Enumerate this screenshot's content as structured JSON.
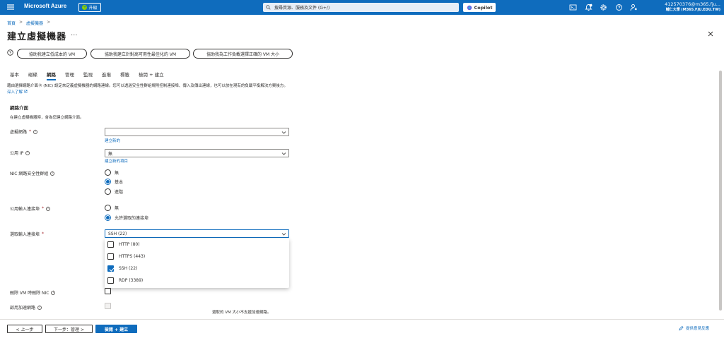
{
  "topbar": {
    "brand": "Microsoft Azure",
    "upgrade_label": "升級",
    "search_placeholder": "搜尋資源、服務及文件 (G+/)",
    "copilot_label": "Copilot",
    "notification_count": "2",
    "account_email": "412570376@m365.fju...",
    "account_org": "輔仁大學 (M365.FJU.EDU.TW)"
  },
  "breadcrumb": {
    "home": "首頁",
    "sep": ">",
    "parent": "虛擬機器",
    "sep2": ">"
  },
  "page": {
    "title": "建立虛擬機器",
    "more": "..."
  },
  "presets": [
    "協助我建立低成本的 VM",
    "協助我建立針對高可用性最佳化的 VM",
    "協助我為工作負載選擇正確的 VM 大小"
  ],
  "tabs": [
    "基本",
    "磁碟",
    "網路",
    "管理",
    "監視",
    "進階",
    "標籤",
    "檢閱 + 建立"
  ],
  "active_tab": "網路",
  "description": {
    "text": "藉由選擇網路介面卡 (NIC) 設定來定義虛擬機器的網路連線。您可以透過安全性群組規則控制連接埠、傳入及傳出連線，也可以放在現有的負載平衡解決方案後方。",
    "link": "深入了解"
  },
  "section": {
    "heading": "網路介面",
    "subtitle": "在建立虛擬機器時，會為您建立網路介面。"
  },
  "fields": {
    "vnet": {
      "label": "虛擬網路",
      "required": "*",
      "value": "",
      "link": "建立新的"
    },
    "public_ip": {
      "label": "公用 IP",
      "value": "無",
      "link": "建立新的項目"
    },
    "nsg": {
      "label": "NIC 網路安全性群組",
      "options": [
        "無",
        "基本",
        "進階"
      ],
      "selected": 1
    },
    "inbound": {
      "label": "公用輸入連接埠",
      "required": "*",
      "options": [
        "無",
        "允許選取的連接埠"
      ],
      "selected": 1
    },
    "select_ports": {
      "label": "選取輸入連接埠",
      "required": "*",
      "value": "SSH (22)",
      "options": [
        {
          "label": "HTTP (80)",
          "checked": false
        },
        {
          "label": "HTTPS (443)",
          "checked": false
        },
        {
          "label": "SSH (22)",
          "checked": true
        },
        {
          "label": "RDP (3389)",
          "checked": false
        }
      ]
    },
    "delete_nic": {
      "label": "刪除 VM 時刪除 NIC"
    },
    "accel_net": {
      "label": "啟用加速網路"
    }
  },
  "accel_note": "選取的 VM 大小不支援加速網路。",
  "footer": {
    "prev": "< 上一步",
    "next": "下一步：管理 >",
    "review": "檢閱 + 建立",
    "feedback": "提供意見反應"
  },
  "colors": {
    "accent": "#0f6cbd",
    "topbar": "#0f6cbd"
  }
}
